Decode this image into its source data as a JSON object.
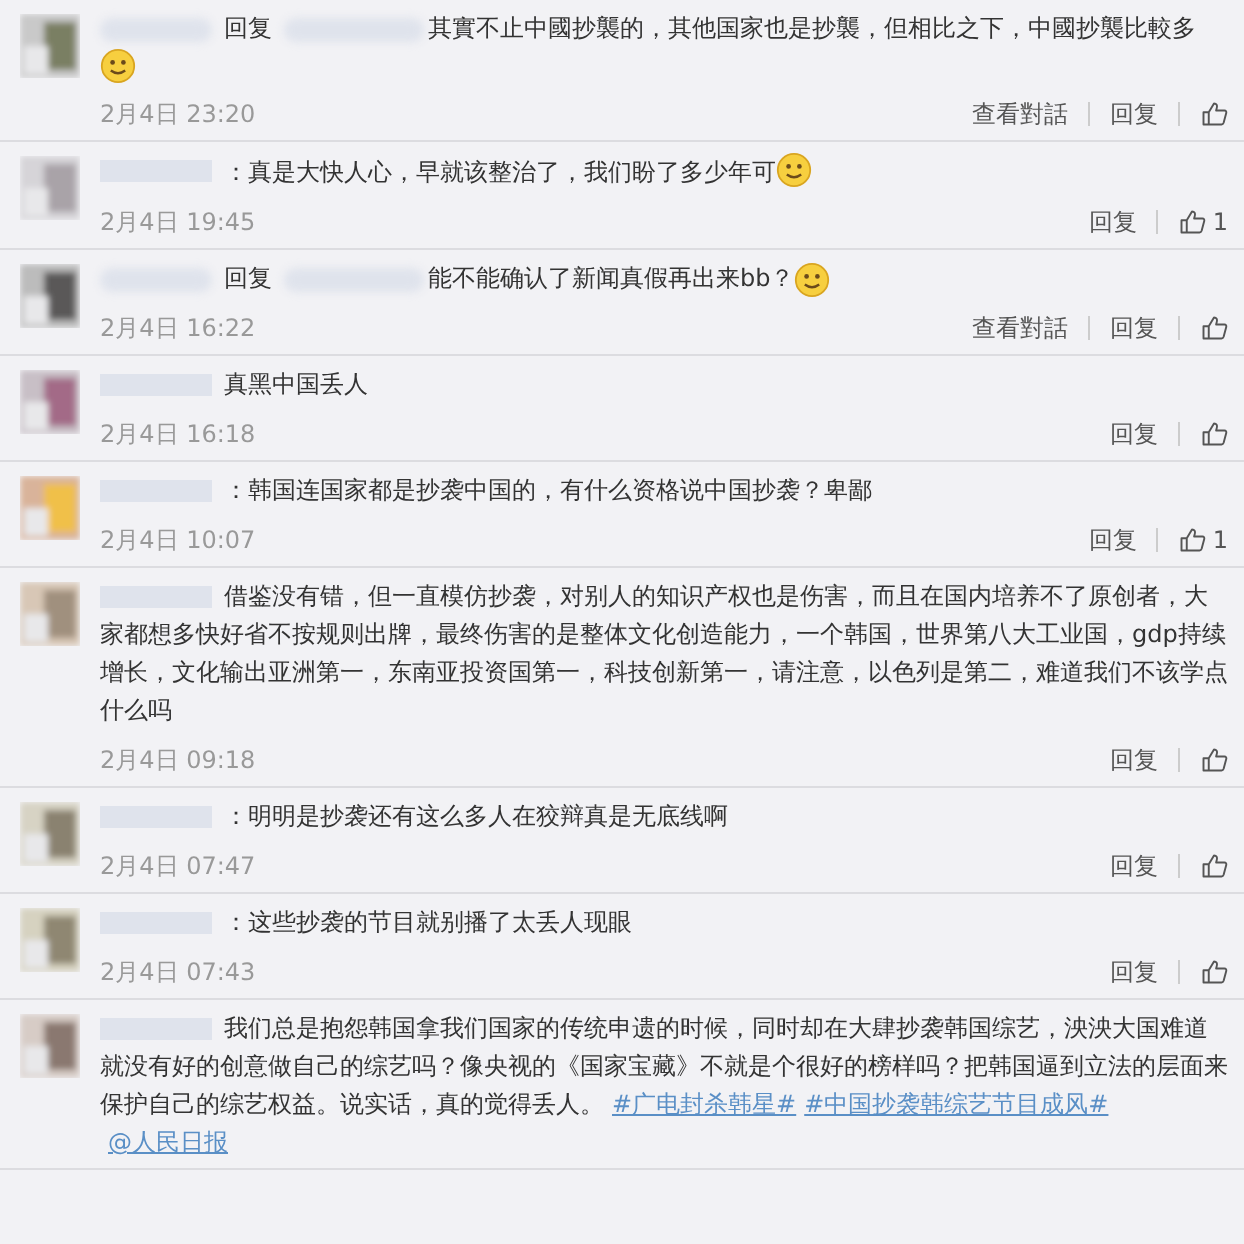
{
  "comments": [
    {
      "reply_label": "回复",
      "text": "其實不止中國抄襲的，其他国家也是抄襲，但相比之下，中國抄襲比較多",
      "emoji": true,
      "date": "2月4日 23:20",
      "view_conversation": "查看對話",
      "reply": "回复"
    },
    {
      "text": "：真是大快人心，早就该整治了，我们盼了多少年可",
      "emoji": true,
      "date": "2月4日 19:45",
      "reply": "回复",
      "likes": "1"
    },
    {
      "reply_label": "回复",
      "text": "能不能确认了新闻真假再出来bb？",
      "emoji": true,
      "date": "2月4日 16:22",
      "view_conversation": "查看對話",
      "reply": "回复"
    },
    {
      "text": "真黑中国丢人",
      "date": "2月4日 16:18",
      "reply": "回复"
    },
    {
      "text": "：韩国连国家都是抄袭中国的，有什么资格说中国抄袭？卑鄙",
      "date": "2月4日 10:07",
      "reply": "回复",
      "likes": "1"
    },
    {
      "text": "借鉴没有错，但一直模仿抄袭，对别人的知识产权也是伤害，而且在国内培养不了原创者，大家都想多快好省不按规则出牌，最终伤害的是整体文化创造能力，一个韩国，世界第八大工业国，gdp持续增长，文化输出亚洲第一，东南亚投资国第一，科技创新第一，请注意，以色列是第二，难道我们不该学点什么吗",
      "date": "2月4日 09:18",
      "reply": "回复"
    },
    {
      "text": "：明明是抄袭还有这么多人在狡辩真是无底线啊",
      "date": "2月4日 07:47",
      "reply": "回复"
    },
    {
      "text": "：这些抄袭的节目就别播了太丢人现眼",
      "date": "2月4日 07:43",
      "reply": "回复"
    },
    {
      "text": "我们总是抱怨韩国拿我们国家的传统申遗的时候，同时却在大肆抄袭韩国综艺，泱泱大国难道就没有好的创意做自己的综艺吗？像央视的《国家宝藏》不就是个很好的榜样吗？把韩国逼到立法的层面来保护自己的综艺权益。说实话，真的觉得丢人。",
      "links": [
        "#广电封杀韩星#",
        "#中国抄袭韩综艺节目成风#",
        "@人民日报"
      ]
    }
  ]
}
